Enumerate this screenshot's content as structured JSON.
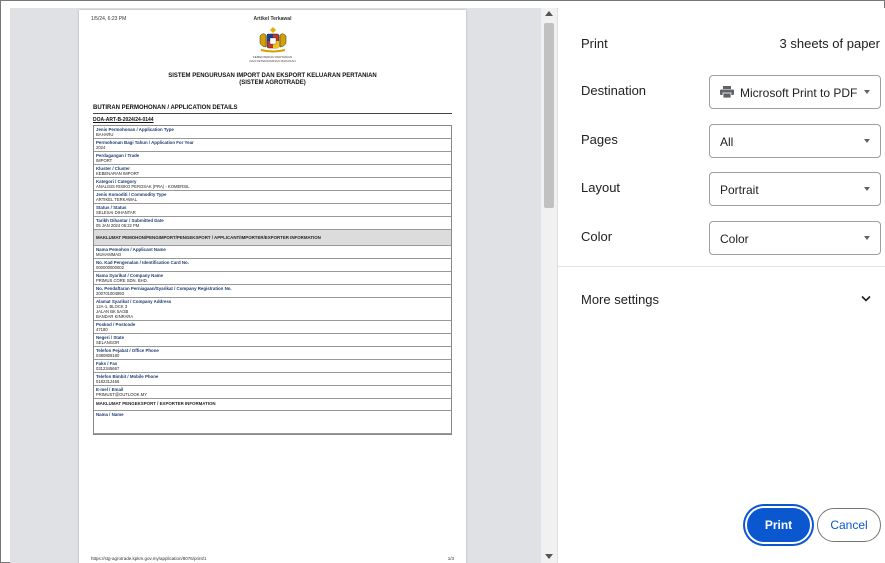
{
  "preview": {
    "header_left": "1/5/24, 6:23 PM",
    "header_center": "Artikel Terkawal",
    "ministry": "KEMENTERIAN PERTANIAN\nDAN KETERJAMINAN MAKANAN",
    "system_line1": "SISTEM PENGURUSAN IMPORT DAN EKSPORT KELUARAN PERTANIAN",
    "system_line2": "(SISTEM AGROTRADE)",
    "section_title": "BUTIRAN PERMOHONAN / APPLICATION DETAILS",
    "reference": "DOA-ART-B-2024/24-0144",
    "rows": [
      {
        "label": "Jenis Permohonan / Application Type",
        "value": "BAHARU"
      },
      {
        "label": "Permohonan Bagi Tahun / Application For Year",
        "value": "2024"
      },
      {
        "label": "Perdagangan / Trade",
        "value": "IMPORT"
      },
      {
        "label": "Kluster / Cluster",
        "value": "KEBENARAN IMPORT"
      },
      {
        "label": "Kategori / Category",
        "value": "ANALISIS RISIKO PEROSAK (PRA) - KOMERSIL"
      },
      {
        "label": "Jenis Komoditi / Commodity Type",
        "value": "ARTIKEL TERKAWAL"
      },
      {
        "label": "Status / Status",
        "value": "SELESAI DIHANTAR"
      },
      {
        "label": "Tarikh Dihantar / Submitted Date",
        "value": "05 JAN 2024 06:22 PM"
      }
    ],
    "applicant_band": "MAKLUMAT PEMOHON/PENGIMPORT/PENGEKSPORT / APPLICANT/IMPORTER/EXPORTER INFORMATION",
    "applicant_rows": [
      {
        "label": "Nama Pemohon / Applicant Name",
        "value": "MUHAMMAD"
      },
      {
        "label": "No. Kad Pengenalan / Identification Card No.",
        "value": "000000000002"
      },
      {
        "label": "Nama Syarikat / Company Name",
        "value": "PRIMUS CORE SDN. BHD."
      },
      {
        "label": "No. Pendaftaran Perniagaan/Syarikat / Company Registration No.",
        "value": "200701004993"
      },
      {
        "label": "Alamat Syarikat / Company Address",
        "value": "12A-1, BLOCK 3\nJALAN BK 5A/2B\nBANDAR KINRARA"
      },
      {
        "label": "Poskod / Postcode",
        "value": "47180"
      },
      {
        "label": "Negeri / State",
        "value": "SELANGOR"
      },
      {
        "label": "Telefon Pejabat / Office Phone",
        "value": "0380809180"
      },
      {
        "label": "Faks / Fax",
        "value": "0312345667"
      },
      {
        "label": "Telefon Bimbit / Mobile Phone",
        "value": "0182312456"
      },
      {
        "label": "E-mel / Email",
        "value": "PRIMUST@OUTLOOK.MY"
      }
    ],
    "exporter_band": "MAKLUMAT PENGEKSPORT / EXPORTER INFORMATION",
    "exporter_rows": [
      {
        "label": "Nama / Name",
        "value": ""
      }
    ],
    "footer_url": "https://stg-agrotrade.kpkm.gov.my/application/8076/print/1",
    "footer_page": "1/3"
  },
  "settings": {
    "title": "Print",
    "sheets": "3 sheets of paper",
    "destination_label": "Destination",
    "destination_value": "Microsoft Print to PDF",
    "pages_label": "Pages",
    "pages_value": "All",
    "layout_label": "Layout",
    "layout_value": "Portrait",
    "color_label": "Color",
    "color_value": "Color",
    "more_settings": "More settings",
    "print_button": "Print",
    "cancel_button": "Cancel"
  },
  "icons": {
    "destination": "printer-icon",
    "dropdown": "caret-down-icon",
    "more": "chevron-down-icon",
    "crest": "malaysia-coat-of-arms-logo"
  },
  "colors": {
    "accent": "#0b57d0",
    "label_text": "#1e3c72",
    "preview_bg": "#dfe1e5"
  }
}
